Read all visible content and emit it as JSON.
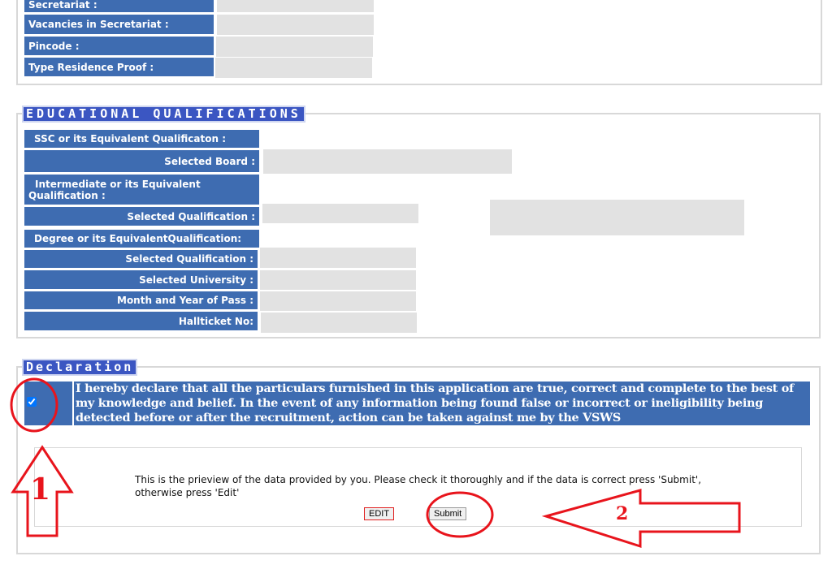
{
  "residence": {
    "labels": [
      "Secretariat :",
      "Vacancies in Secretariat :",
      "Pincode :",
      "Type Residence Proof :"
    ]
  },
  "education": {
    "legend": "EDUCATIONAL QUALIFICATIONS",
    "ssc": "SSC or its Equivalent Qualificaton :",
    "board": "Selected Board :",
    "inter": "Intermediate or its Equivalent Qualification :",
    "inter_qual": "Selected Qualification :",
    "degree": "Degree or its EquivalentQualification:",
    "degree_qual": "Selected Qualification :",
    "university": "Selected University :",
    "month_year": "Month and Year of Pass :",
    "hallticket": "Hallticket No:"
  },
  "declaration": {
    "legend": "Declaration",
    "checked": true,
    "text": "I hereby declare that all the particulars furnished in this application are true, correct and complete to the best of my knowledge and belief. In the event of any information being found false or incorrect or ineligibility being detected before or after the recruitment, action can be taken against me by the VSWS",
    "preview_text": "This is the prieview of the data provided by you. Please check it thoroughly and if the data is correct press 'Submit', otherwise press 'Edit'",
    "edit_label": "EDIT",
    "submit_label": "Submit"
  },
  "annotations": {
    "step1": "1",
    "step2": "2",
    "color": "#e8141c"
  }
}
